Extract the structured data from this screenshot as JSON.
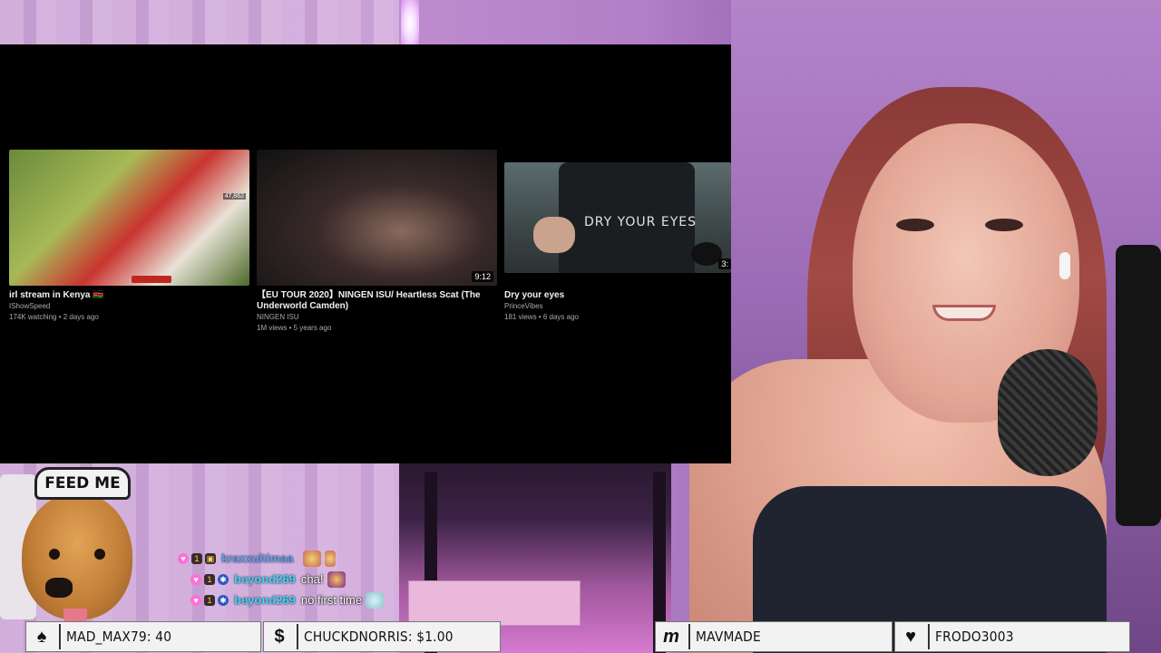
{
  "videos": [
    {
      "title": "irl stream in Kenya 🇰🇪",
      "channel": "IShowSpeed",
      "stats": "174K watching • 2 days ago",
      "overlay_count": "47,862"
    },
    {
      "title": "【EU TOUR 2020】NINGEN ISU/ Heartless Scat (The Underworld Camden)",
      "channel": "NINGEN ISU",
      "stats": "1M views • 5 years ago",
      "duration": "9:12"
    },
    {
      "title": "Dry your eyes",
      "channel": "PrinceVibes",
      "stats": "181 views • 6 days ago",
      "thumb_text": "DRY YOUR EYES",
      "duration": "3:"
    }
  ],
  "mascot": {
    "label": "FEED ME"
  },
  "chat": [
    {
      "user": "kraxxultimaa",
      "message": ""
    },
    {
      "user": "beyond269",
      "message": "cha!"
    },
    {
      "user": "beyond269",
      "message": "no first time"
    }
  ],
  "alerts": [
    {
      "icon": "spade-icon",
      "text": "MAD_MAX79: 40"
    },
    {
      "icon": "dollar-icon",
      "text": "CHUCKDNORRIS: $1.00"
    },
    {
      "icon": "m-logo-icon",
      "text": "MAVMADE"
    },
    {
      "icon": "heart-icon",
      "text": "FRODO3003"
    }
  ],
  "colors": {
    "chat_username": "#3bd6ff",
    "yt_background": "#000000",
    "alert_bar": "#f2f2f2",
    "room_light": "#c08fcf"
  }
}
